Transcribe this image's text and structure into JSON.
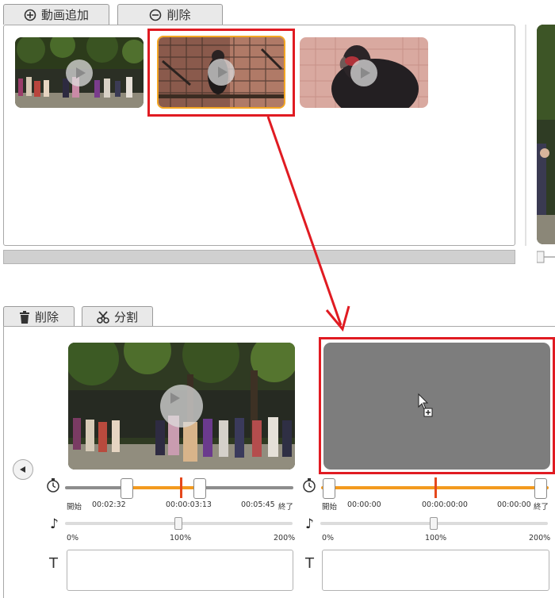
{
  "top_tabs": {
    "add_video": "動画追加",
    "delete": "削除"
  },
  "bottom_tabs": {
    "delete": "削除",
    "split": "分割"
  },
  "clip1": {
    "start_label": "開始",
    "start_time": "00:02:32",
    "current_time": "00:00:03:13",
    "end_time": "00:05:45",
    "end_label": "終了",
    "vol_min": "0%",
    "vol_mid": "100%",
    "vol_max": "200%",
    "text_label": "T",
    "text_value": ""
  },
  "clip2": {
    "start_label": "開始",
    "start_time": "00:00:00",
    "current_time": "00:00:00:00",
    "end_time": "00:00:00",
    "end_label": "終了",
    "vol_min": "0%",
    "vol_mid": "100%",
    "vol_max": "200%",
    "text_label": "T",
    "text_value": ""
  },
  "icons": {
    "add": "plus-circle-icon",
    "remove": "minus-circle-icon",
    "trash": "trash-icon",
    "scissors": "scissors-icon",
    "timer": "stopwatch-icon",
    "volume": "music-note-icon",
    "back": "left-arrow-icon"
  },
  "colors": {
    "accent_orange": "#f39a1e",
    "highlight_red": "#e01b22",
    "drop_area": "#7d7d7d"
  }
}
